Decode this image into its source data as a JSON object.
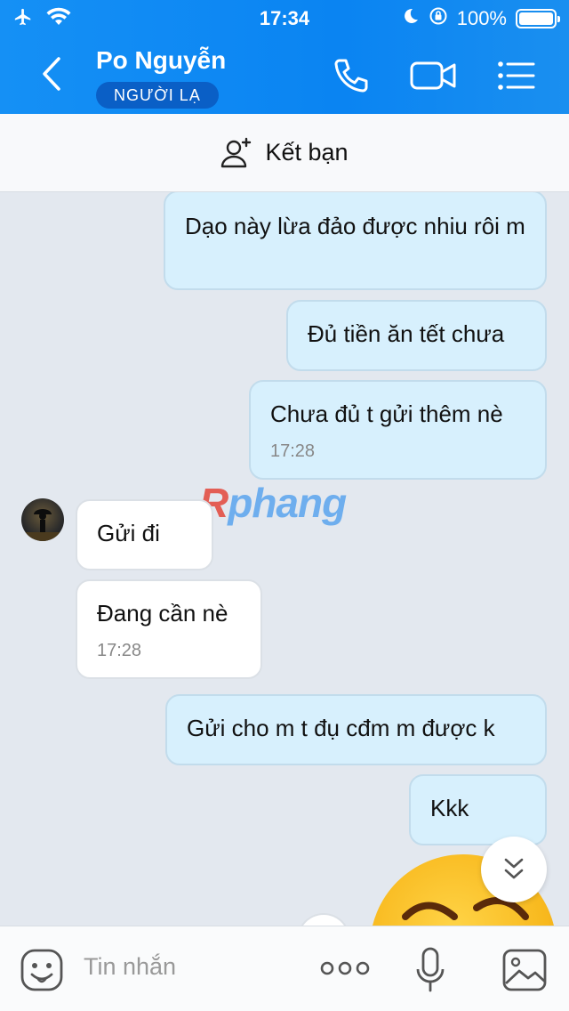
{
  "status": {
    "time": "17:34",
    "battery": "100%"
  },
  "header": {
    "name": "Po Nguyễn",
    "badge": "NGƯỜI LẠ"
  },
  "friend_bar": {
    "label": "Kết bạn"
  },
  "messages": [
    {
      "side": "out",
      "text": "Dạo này lừa đảo được nhiu rôi m"
    },
    {
      "side": "out",
      "text": "Đủ tiền ăn tết chưa"
    },
    {
      "side": "out",
      "text": "Chưa đủ t gửi thêm nè",
      "time": "17:28"
    },
    {
      "side": "in",
      "text": "Gửi đi"
    },
    {
      "side": "in",
      "text": "Đang cần nè",
      "time": "17:28"
    },
    {
      "side": "out",
      "text": "Gửi cho m t đụ cđm m được k"
    },
    {
      "side": "out",
      "text": "Kkk"
    }
  ],
  "watermark": {
    "prefix": "R",
    "rest": "phang"
  },
  "composer": {
    "placeholder": "Tin nhắn"
  },
  "icons": [
    "airplane-icon",
    "wifi-icon",
    "moon-icon",
    "rotation-lock-icon",
    "battery-icon",
    "back-icon",
    "phone-icon",
    "video-call-icon",
    "menu-icon",
    "add-friend-icon",
    "scroll-down-icon",
    "sticker-icon",
    "more-icon",
    "microphone-icon",
    "image-icon"
  ],
  "colors": {
    "header": "#0a84f2",
    "outgoing_bubble": "#d7f0fd",
    "incoming_bubble": "#ffffff",
    "chat_bg": "#e3e8ef"
  }
}
